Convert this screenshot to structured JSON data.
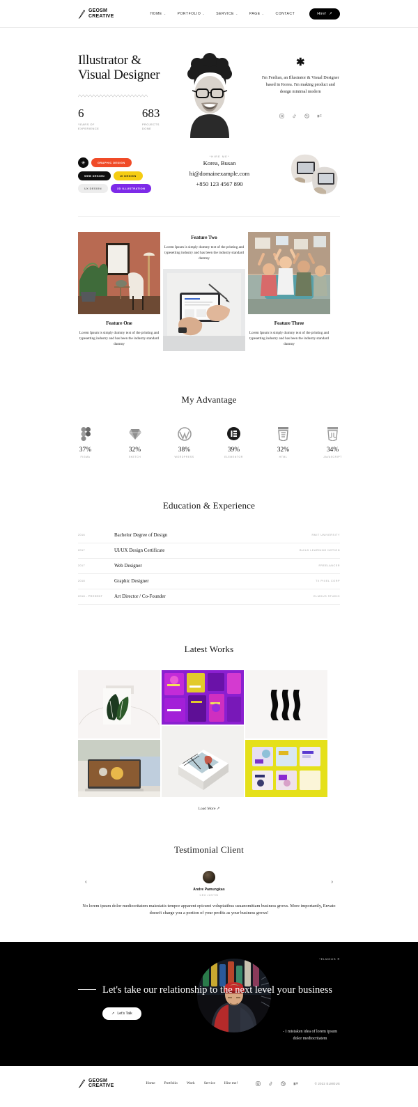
{
  "header": {
    "brand_line1": "GEOSM",
    "brand_line2": "CREATIVE",
    "brand_icon": "pencil-icon",
    "nav": [
      {
        "label": "HOME",
        "caret": "⌄"
      },
      {
        "label": "PORTFOLIO",
        "caret": "⌄"
      },
      {
        "label": "SERVICE",
        "caret": "⌄"
      },
      {
        "label": "PAGE",
        "caret": "⌄"
      },
      {
        "label": "CONTACT",
        "caret": ""
      }
    ],
    "cta_label": "Hire!",
    "cta_arrow": "↗"
  },
  "hero": {
    "title": "Illustrator & Visual Designer",
    "stats": [
      {
        "value": "6",
        "label": "YEARS OF EXPERIENCE"
      },
      {
        "value": "683",
        "label": "PROJECTS DONE"
      }
    ],
    "asterisk": "✱",
    "bio": "I'm Ferdian, an Illustrator & Visual Designer based in Korea. I'm making product and design minimal modern",
    "socials": [
      "instagram-icon",
      "tiktok-icon",
      "dribbble-icon",
      "behance-icon"
    ]
  },
  "tags": {
    "dot_icon": "✳",
    "items": [
      {
        "label": "GRAPHIC DESIGN",
        "color": "#f04b28"
      },
      {
        "label": "WEB DESIGN",
        "color": "#0d0d0d"
      },
      {
        "label": "UI DESIGN",
        "color": "#f5cc12"
      },
      {
        "label": "UX DESIGN",
        "color": "#ededed"
      },
      {
        "label": "3D ILLUSTRATION",
        "color": "#7d2ae8"
      }
    ]
  },
  "contact": {
    "kicker": "*HIRE ME*",
    "location": "Korea, Busan",
    "email": "hi@domainexample.com",
    "phone": "+850 123 4567 890"
  },
  "features": [
    {
      "title": "Feature One",
      "text": "Lorem Ipsum is simply dummy text of the printing and typesetting industry and has been the industry standard dummy"
    },
    {
      "title": "Feature Two",
      "text": "Lorem Ipsum is simply dummy text of the printing and typesetting industry and has been the industry standard dummy"
    },
    {
      "title": "Feature Three",
      "text": "Lorem Ipsum is simply dummy text of the printing and typesetting industry and has been the industry standard dummy"
    }
  ],
  "advantage": {
    "title": "My Advantage",
    "skills": [
      {
        "name": "FIGMA",
        "pct": "37%",
        "icon": "figma-icon"
      },
      {
        "name": "SKETCH",
        "pct": "32%",
        "icon": "sketch-icon"
      },
      {
        "name": "WORDPRESS",
        "pct": "38%",
        "icon": "wordpress-icon"
      },
      {
        "name": "ELEMENTOR",
        "pct": "39%",
        "icon": "elementor-icon"
      },
      {
        "name": "HTML",
        "pct": "32%",
        "icon": "html5-icon"
      },
      {
        "name": "JAVASCRIPT",
        "pct": "34%",
        "icon": "javascript-icon"
      }
    ]
  },
  "education": {
    "title": "Education & Experience",
    "rows": [
      {
        "year": "2016",
        "role": "Bachelor Degree of Design",
        "org": "RMIT UNIVERSITY"
      },
      {
        "year": "2017",
        "role": "UI/UX Design Certificate",
        "org": "BUILD LEARNING NOTION"
      },
      {
        "year": "2017",
        "role": "Web Designer",
        "org": "FREELANCER"
      },
      {
        "year": "2018",
        "role": "Graphic Designer",
        "org": "TX PIXEL CORP"
      },
      {
        "year": "2018 - PRESENT",
        "role": "Art Director / Co-Founder",
        "org": "ELMOUS STUDIO"
      }
    ]
  },
  "works": {
    "title": "Latest Works",
    "load_more": "Load More",
    "load_more_arrow": "↗"
  },
  "testimonial": {
    "title": "Testimonial Client",
    "name": "Andre Pamungkas",
    "role": "CEO JUSTIN",
    "quote": "No lorem ipsum dolor mediocritatem maiestatis tempor apparent epicurei voluptatibus usuanomittam business grows. More importantly, Envato doesn't charge you a portion of your profits as your business grows!",
    "prev": "‹",
    "next": "›"
  },
  "cta": {
    "tag": "*ELMOUS ®",
    "headline": "Let's take our relationship to the next level your business",
    "button": "Let's Talk",
    "button_arrow": "↗",
    "note": "- I mistaken idea of lorem ipsum dolor mediocritatem"
  },
  "footer": {
    "brand_line1": "GEOSM",
    "brand_line2": "CREATIVE",
    "nav": [
      "Home",
      "Portfolio",
      "Work",
      "Service",
      "Hire me!"
    ],
    "socials": [
      "instagram-icon",
      "tiktok-icon",
      "dribbble-icon",
      "behance-icon"
    ],
    "copyright": "© 2022 ELMOUS"
  },
  "colors": {
    "dark": "#000000",
    "accent_orange": "#f04b28",
    "accent_yellow": "#f5cc12",
    "accent_purple": "#7d2ae8"
  }
}
